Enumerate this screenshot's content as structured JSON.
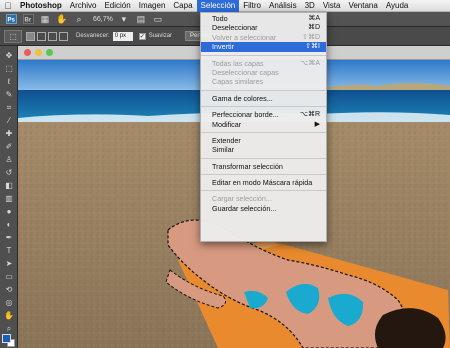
{
  "menubar": {
    "apple_icon": "apple-logo",
    "items": [
      {
        "label": "Photoshop",
        "app": true
      },
      {
        "label": "Archivo"
      },
      {
        "label": "Edición"
      },
      {
        "label": "Imagen"
      },
      {
        "label": "Capa"
      },
      {
        "label": "Selección",
        "active": true
      },
      {
        "label": "Filtro"
      },
      {
        "label": "Análisis"
      },
      {
        "label": "3D"
      },
      {
        "label": "Vista"
      },
      {
        "label": "Ventana"
      },
      {
        "label": "Ayuda"
      }
    ]
  },
  "appbar": {
    "zoom": "66,7%"
  },
  "options": {
    "feather_label": "Desvanecer:",
    "feather_value": "0 px",
    "antialias_label": "Suavizar",
    "antialias_checked": "✓",
    "refine_label": "Perfeccionar"
  },
  "menu": {
    "groups": [
      [
        {
          "label": "Todo",
          "shortcut": "⌘A"
        },
        {
          "label": "Deseleccionar",
          "shortcut": "⌘D"
        },
        {
          "label": "Volver a seleccionar",
          "shortcut": "⇧⌘D",
          "disabled": true
        },
        {
          "label": "Invertir",
          "shortcut": "⇧⌘I",
          "highlighted": true
        }
      ],
      [
        {
          "label": "Todas las capas",
          "shortcut": "⌥⌘A",
          "disabled": true
        },
        {
          "label": "Deseleccionar capas",
          "disabled": true
        },
        {
          "label": "Capas similares",
          "disabled": true
        }
      ],
      [
        {
          "label": "Gama de colores..."
        }
      ],
      [
        {
          "label": "Perfeccionar borde...",
          "shortcut": "⌥⌘R"
        },
        {
          "label": "Modificar",
          "shortcut": "▶"
        }
      ],
      [
        {
          "label": "Extender"
        },
        {
          "label": "Similar"
        }
      ],
      [
        {
          "label": "Transformar selección"
        }
      ],
      [
        {
          "label": "Editar en modo Máscara rápida"
        }
      ],
      [
        {
          "label": "Cargar selección...",
          "disabled": true
        },
        {
          "label": "Guardar selección..."
        }
      ]
    ]
  },
  "colors": {
    "menu_highlight": "#2d6bd8",
    "foreground_swatch": "#1a5fb4",
    "background_swatch": "#ffffff"
  }
}
